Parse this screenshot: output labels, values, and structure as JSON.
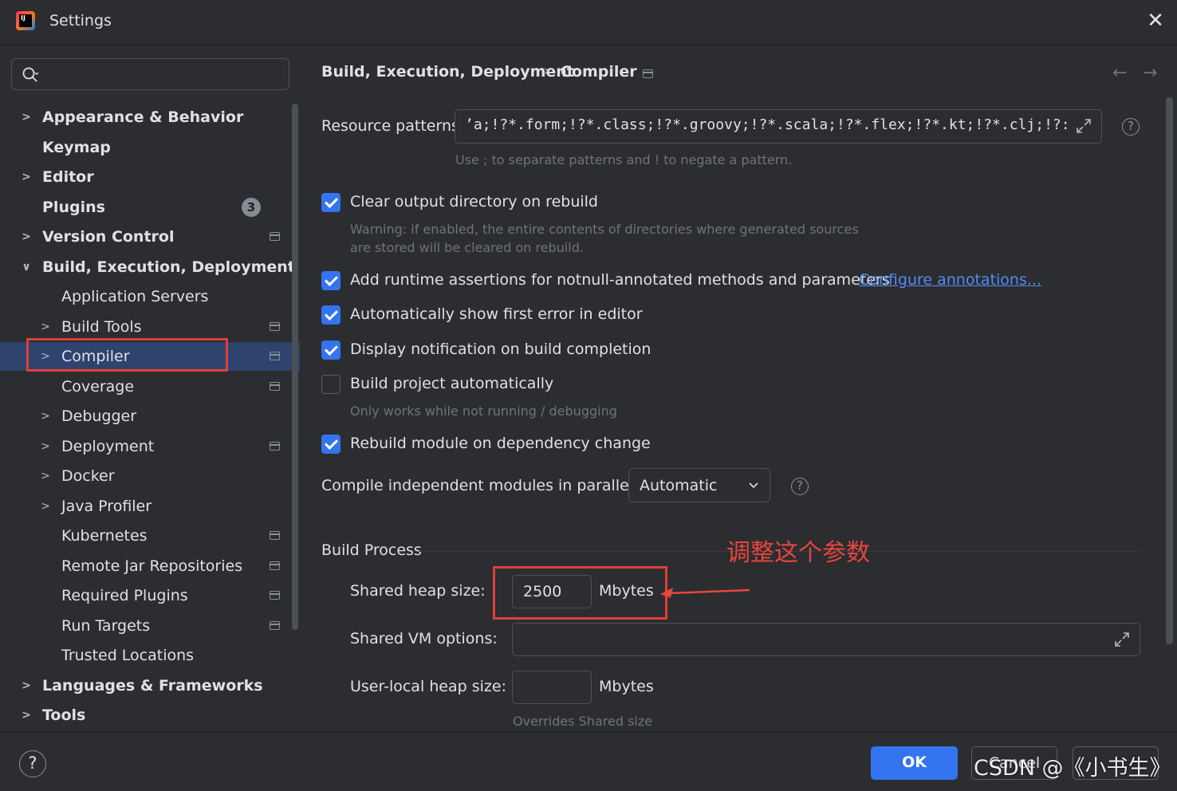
{
  "window": {
    "title": "Settings"
  },
  "sidebar": {
    "search_placeholder": "",
    "items": [
      {
        "label": "Appearance & Behavior",
        "expandable": true
      },
      {
        "label": "Keymap"
      },
      {
        "label": "Editor",
        "expandable": true
      },
      {
        "label": "Plugins",
        "badge": "3"
      },
      {
        "label": "Version Control",
        "expandable": true
      },
      {
        "label": "Build, Execution, Deployment",
        "expanded": true
      },
      {
        "label": "Application Servers"
      },
      {
        "label": "Build Tools"
      },
      {
        "label": "Compiler",
        "selected": true
      },
      {
        "label": "Coverage"
      },
      {
        "label": "Debugger"
      },
      {
        "label": "Deployment"
      },
      {
        "label": "Docker"
      },
      {
        "label": "Java Profiler"
      },
      {
        "label": "Kubernetes"
      },
      {
        "label": "Remote Jar Repositories"
      },
      {
        "label": "Required Plugins"
      },
      {
        "label": "Run Targets"
      },
      {
        "label": "Trusted Locations"
      },
      {
        "label": "Languages & Frameworks",
        "expandable": true
      },
      {
        "label": "Tools",
        "expandable": true
      }
    ]
  },
  "breadcrumb": {
    "parent": "Build, Execution, Deployment",
    "separator": "›",
    "current": "Compiler"
  },
  "compiler": {
    "resource_patterns_label": "Resource patterns:",
    "resource_patterns_value": "ʼa;!?*.form;!?*.class;!?*.groovy;!?*.scala;!?*.flex;!?*.kt;!?*.clj;!?:",
    "resource_patterns_hint": "Use ; to separate patterns and ! to negate a pattern.",
    "clear_output_label": "Clear output directory on rebuild",
    "clear_output_checked": true,
    "clear_output_warning_1": "Warning: if enabled, the entire contents of directories where generated sources",
    "clear_output_warning_2": "are stored will be cleared on rebuild.",
    "runtime_assertions_label": "Add runtime assertions for notnull-annotated methods and parameters",
    "runtime_assertions_checked": true,
    "configure_annotations_link": "Configure annotations...",
    "show_first_error_label": "Automatically show first error in editor",
    "show_first_error_checked": true,
    "display_notification_label": "Display notification on build completion",
    "display_notification_checked": true,
    "build_auto_label": "Build project automatically",
    "build_auto_checked": false,
    "build_auto_hint": "Only works while not running / debugging",
    "rebuild_module_label": "Rebuild module on dependency change",
    "rebuild_module_checked": true,
    "parallel_label": "Compile independent modules in parallel:",
    "parallel_value": "Automatic"
  },
  "build_process": {
    "section_title": "Build Process",
    "shared_heap_label": "Shared heap size:",
    "shared_heap_value": "2500",
    "shared_heap_unit": "Mbytes",
    "shared_vm_label": "Shared VM options:",
    "shared_vm_value": "",
    "user_heap_label": "User-local heap size:",
    "user_heap_value": "",
    "user_heap_unit": "Mbytes",
    "user_heap_hint": "Overrides Shared size"
  },
  "annotation": {
    "text": "调整这个参数",
    "color": "#e8453c"
  },
  "footer": {
    "help": "?",
    "ok_label": "OK",
    "cancel_label": "Cancel",
    "apply_label": ""
  },
  "watermark": "CSDN @《小书生》",
  "colors": {
    "accent": "#3574f0",
    "selected_row": "#2e436e",
    "link": "#548af7",
    "highlight_box": "#e0403a"
  }
}
